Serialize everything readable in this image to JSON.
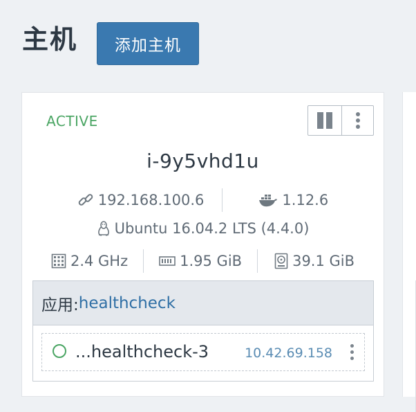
{
  "page": {
    "title": "主机",
    "add_host_label": "添加主机"
  },
  "host": {
    "state": "ACTIVE",
    "hostname": "i-9y5vhd1u",
    "ip": "192.168.100.6",
    "docker_version": "1.12.6",
    "os": "Ubuntu 16.04.2 LTS (4.4.0)",
    "cpu": "2.4 GHz",
    "memory": "1.95 GiB",
    "storage": "39.1 GiB",
    "icons": {
      "ip": "link-icon",
      "docker": "docker-icon",
      "os": "linux-icon",
      "cpu": "cpu-icon",
      "memory": "memory-icon",
      "storage": "storage-icon",
      "pause": "pause-icon",
      "more": "more-vertical-icon"
    }
  },
  "stack": {
    "label": "应用: ",
    "name": "healthcheck",
    "containers": [
      {
        "name": "...healthcheck-3",
        "ip": "10.42.69.158",
        "status_color": "#4aa563"
      }
    ]
  },
  "colors": {
    "accent": "#3a79b0",
    "active": "#4aa563",
    "link": "#2f6fa5"
  }
}
